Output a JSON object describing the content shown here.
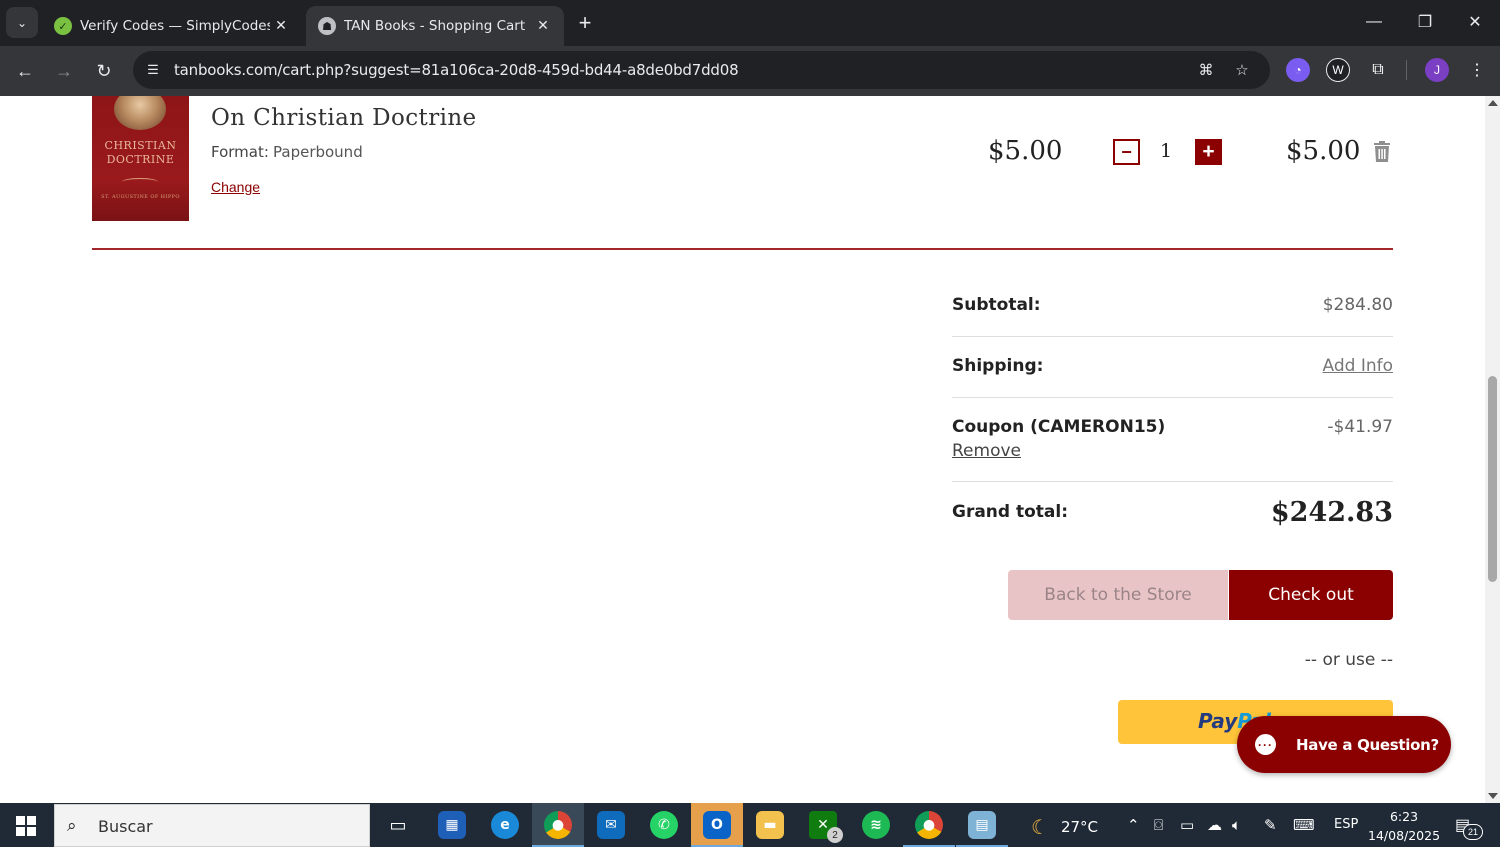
{
  "browser": {
    "tabs": [
      {
        "title": "Verify Codes — SimplyCodes",
        "active": false
      },
      {
        "title": "TAN Books - Shopping Cart",
        "active": true
      }
    ],
    "url": "tanbooks.com/cart.php?suggest=81a106ca-20d8-459d-bd44-a8de0bd7dd08",
    "profile_initial": "J"
  },
  "cart": {
    "item": {
      "cover_title": "CHRISTIAN DOCTRINE",
      "cover_author": "ST. AUGUSTINE OF HIPPO",
      "title": "On Christian Doctrine",
      "format_label": "Format:",
      "format_value": "Paperbound",
      "change_label": "Change",
      "unit_price": "$5.00",
      "quantity": "1",
      "line_total": "$5.00"
    },
    "summary": {
      "subtotal_label": "Subtotal:",
      "subtotal_value": "$284.80",
      "shipping_label": "Shipping:",
      "shipping_value": "Add Info",
      "coupon_label": "Coupon (CAMERON15)",
      "coupon_value": "-$41.97",
      "coupon_remove": "Remove",
      "grand_total_label": "Grand total:",
      "grand_total_value": "$242.83"
    },
    "actions": {
      "back_label": "Back to the Store",
      "checkout_label": "Check out",
      "or_use": "-- or use --",
      "paypal_pay": "Pay",
      "paypal_pal": "Pal"
    },
    "chat": {
      "label": "Have a Question?"
    }
  },
  "colors": {
    "brand": "#8b0000",
    "paypal": "#ffc439"
  },
  "taskbar": {
    "search_placeholder": "Buscar",
    "weather": "27°C",
    "language": "ESP",
    "time": "6:23",
    "date": "14/08/2025",
    "notification_count": "21",
    "xbox_badge": "2"
  }
}
